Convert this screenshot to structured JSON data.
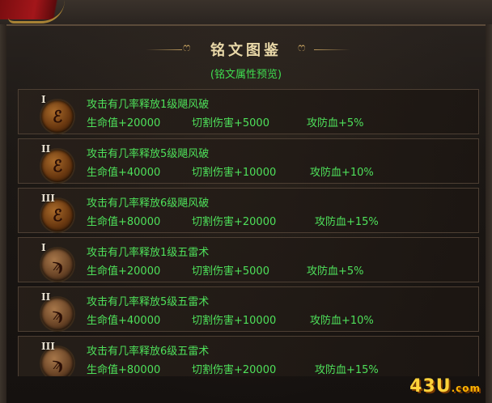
{
  "header": {
    "title": "铭文图鉴",
    "subtitle": "(铭文属性预览)"
  },
  "rows": [
    {
      "rank": "I",
      "skill": "攻击有几率释放1级飓风破",
      "stats": [
        "生命值+20000",
        "切割伤害+5000",
        "攻防血+5%"
      ]
    },
    {
      "rank": "II",
      "skill": "攻击有几率释放5级飓风破",
      "stats": [
        "生命值+40000",
        "切割伤害+10000",
        "攻防血+10%"
      ]
    },
    {
      "rank": "III",
      "skill": "攻击有几率释放6级飓风破",
      "stats": [
        "生命值+80000",
        "切割伤害+20000",
        "攻防血+15%"
      ]
    },
    {
      "rank": "I",
      "skill": "攻击有几率释放1级五雷术",
      "stats": [
        "生命值+20000",
        "切割伤害+5000",
        "攻防血+5%"
      ]
    },
    {
      "rank": "II",
      "skill": "攻击有几率释放5级五雷术",
      "stats": [
        "生命值+40000",
        "切割伤害+10000",
        "攻防血+10%"
      ]
    },
    {
      "rank": "III",
      "skill": "攻击有几率释放6级五雷术",
      "stats": [
        "生命值+80000",
        "切割伤害+20000",
        "攻防血+15%"
      ]
    }
  ],
  "icons": {
    "hurricane": "hurricane-rune-icon",
    "thunder": "thunder-rune-icon"
  },
  "watermark": {
    "main": "43U",
    "suffix": ".com"
  },
  "colors": {
    "accent_green": "#4ee05a",
    "title_gold": "#e9d8a8",
    "ornament_gold": "#b8965a"
  }
}
